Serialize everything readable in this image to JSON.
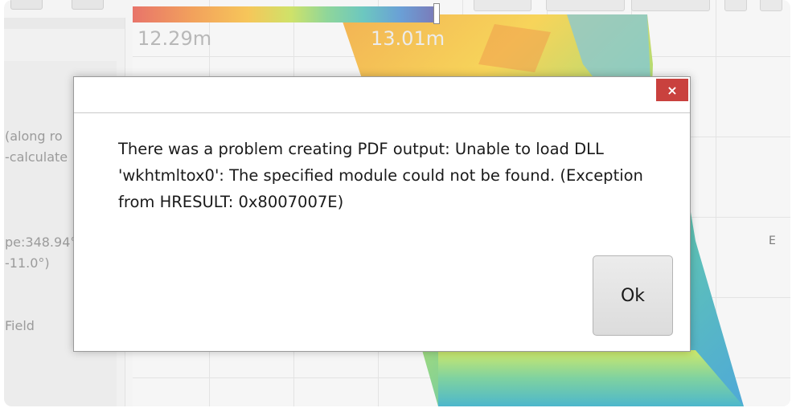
{
  "background": {
    "colorbar_min_label": "12.29m",
    "colorbar_max_label": "13.01m",
    "left_panel_texts": [
      "(along ro",
      "-calculate",
      "pe:348.94°",
      "-11.0°)",
      "Field"
    ],
    "compass_label": "E"
  },
  "dialog": {
    "close_label": "×",
    "message": "There was a problem creating PDF output: Unable to load DLL 'wkhtmltox0': The specified module could not be found. (Exception from HRESULT: 0x8007007E)",
    "ok_label": "Ok"
  },
  "colors": {
    "close_button": "#c9413e",
    "dialog_bg": "#ffffff",
    "ok_button": "#e3e3e3"
  }
}
